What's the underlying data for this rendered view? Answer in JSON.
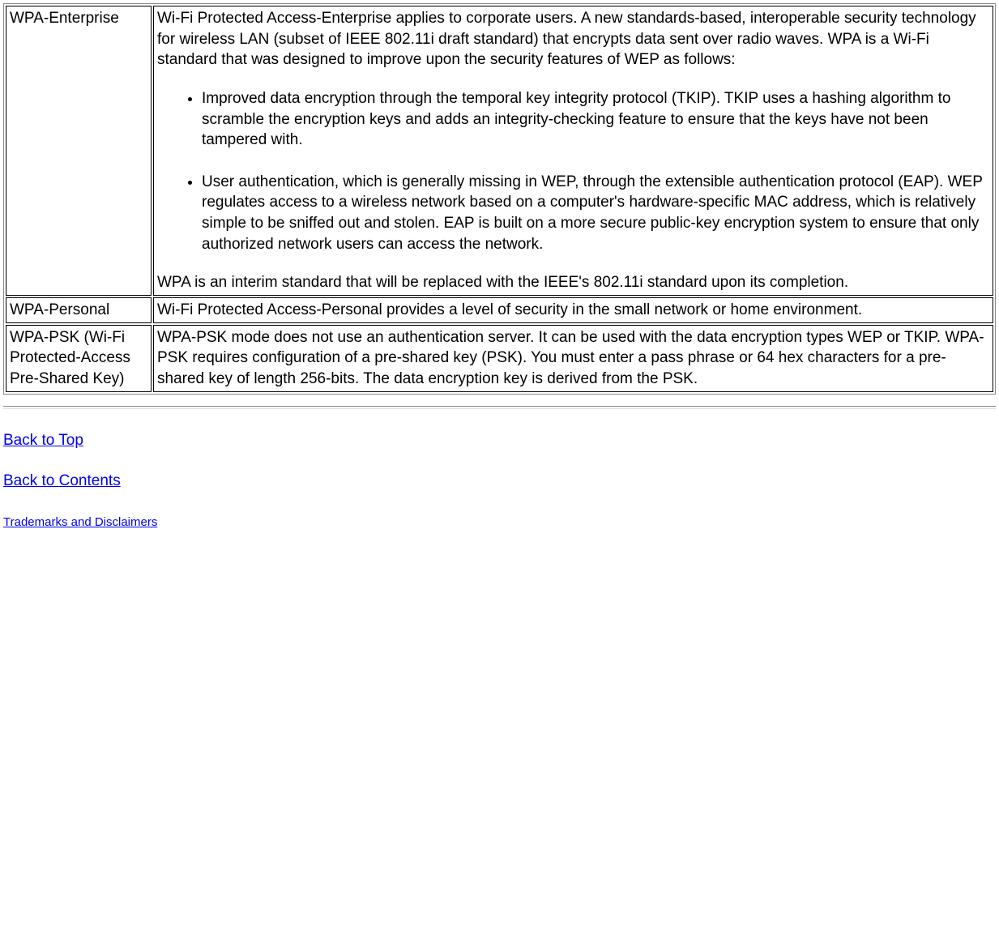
{
  "table": {
    "rows": [
      {
        "term": "WPA-Enterprise",
        "intro": "Wi-Fi Protected Access-Enterprise applies to corporate users. A new standards-based, interoperable security technology for wireless LAN (subset of IEEE 802.11i draft standard) that encrypts data sent over radio waves. WPA is a Wi-Fi standard that was designed to improve upon the security features of WEP as follows:",
        "bullets": [
          "Improved data encryption through the temporal key integrity protocol (TKIP). TKIP uses a hashing algorithm to scramble the encryption keys and adds an integrity-checking feature to ensure that the keys have not been tampered with.",
          "User authentication, which is generally missing in WEP, through the extensible authentication protocol (EAP). WEP regulates access to a wireless network based on a computer's hardware-specific MAC address, which is relatively simple to be sniffed out and stolen. EAP is built on a more secure public-key encryption system to ensure that only authorized network users can access the network."
        ],
        "outro": "WPA is an interim standard that will be replaced with the IEEE's 802.11i standard upon its completion."
      },
      {
        "term": "WPA-Personal",
        "description": "Wi-Fi Protected Access-Personal provides a level of security in the small network or home environment."
      },
      {
        "term": "WPA-PSK (Wi-Fi Protected-Access Pre-Shared Key)",
        "description": "WPA-PSK mode does not use an authentication server. It can be used with the data encryption types WEP or TKIP. WPA-PSK requires configuration of a pre-shared key (PSK). You must enter a pass phrase or 64 hex characters for a pre-shared key of length 256-bits. The data encryption key is derived from the PSK."
      }
    ]
  },
  "links": {
    "back_to_top": "Back to Top",
    "back_to_contents": "Back to Contents",
    "trademarks": "Trademarks and Disclaimers"
  }
}
